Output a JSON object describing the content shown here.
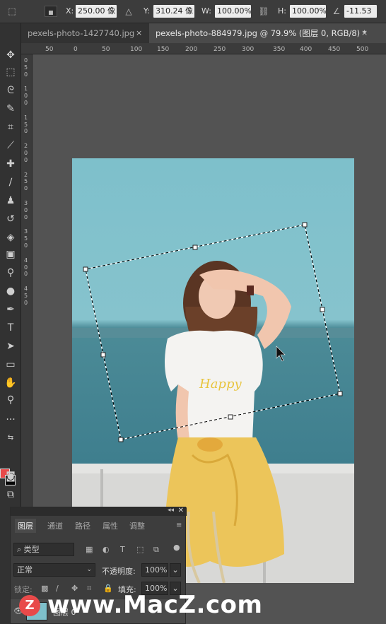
{
  "options_bar": {
    "x_label": "X:",
    "x_value": "250.00 像",
    "y_label": "Y:",
    "y_value": "310.24 像",
    "w_label": "W:",
    "w_value": "100.00%",
    "h_label": "H:",
    "h_value": "100.00%",
    "angle_value": "-11.53"
  },
  "tabs": [
    {
      "label": "pexels-photo-1427740.jpg",
      "close": "×"
    },
    {
      "label": "pexels-photo-884979.jpg @ 79.9% (图层 0, RGB/8) *",
      "close": "×"
    }
  ],
  "ruler_top": [
    "50",
    "0",
    "50",
    "100",
    "150",
    "200",
    "250",
    "300",
    "350",
    "400",
    "450",
    "500"
  ],
  "ruler_left": [
    "0",
    "5",
    "0",
    "1",
    "0",
    "0",
    "1",
    "5",
    "0",
    "2",
    "0",
    "0",
    "2",
    "5",
    "0",
    "3",
    "0",
    "0",
    "3",
    "5",
    "0",
    "4",
    "0",
    "0",
    "4",
    "5",
    "0"
  ],
  "layers_panel": {
    "tabs": [
      "图层",
      "通道",
      "路径",
      "属性",
      "调整"
    ],
    "search_placeholder": "类型",
    "blend_mode": "正常",
    "opacity_label": "不透明度:",
    "opacity_value": "100%",
    "lock_label": "锁定:",
    "fill_label": "填充:",
    "fill_value": "100%",
    "layer_name": "图层 0"
  },
  "watermark": {
    "logo_letter": "Z",
    "text": "www.MacZ.com"
  },
  "colors": {
    "foreground": "#e84a4a",
    "background": "#050505",
    "ui_dark": "#323232",
    "canvas_gray": "#535353"
  },
  "icons": {
    "move": "move-icon",
    "marquee": "marquee-icon",
    "lasso": "lasso-icon",
    "quick_select": "quick-select-icon",
    "crop": "crop-icon",
    "eyedropper": "eyedropper-icon",
    "healing": "healing-icon",
    "brush": "brush-icon",
    "stamp": "stamp-icon",
    "history_brush": "history-brush-icon",
    "eraser": "eraser-icon",
    "gradient": "gradient-icon",
    "blur": "blur-icon",
    "dodge": "dodge-icon",
    "pen": "pen-icon",
    "type": "type-icon",
    "path_select": "path-select-icon",
    "rectangle": "rectangle-icon",
    "hand": "hand-icon",
    "zoom": "zoom-icon"
  }
}
